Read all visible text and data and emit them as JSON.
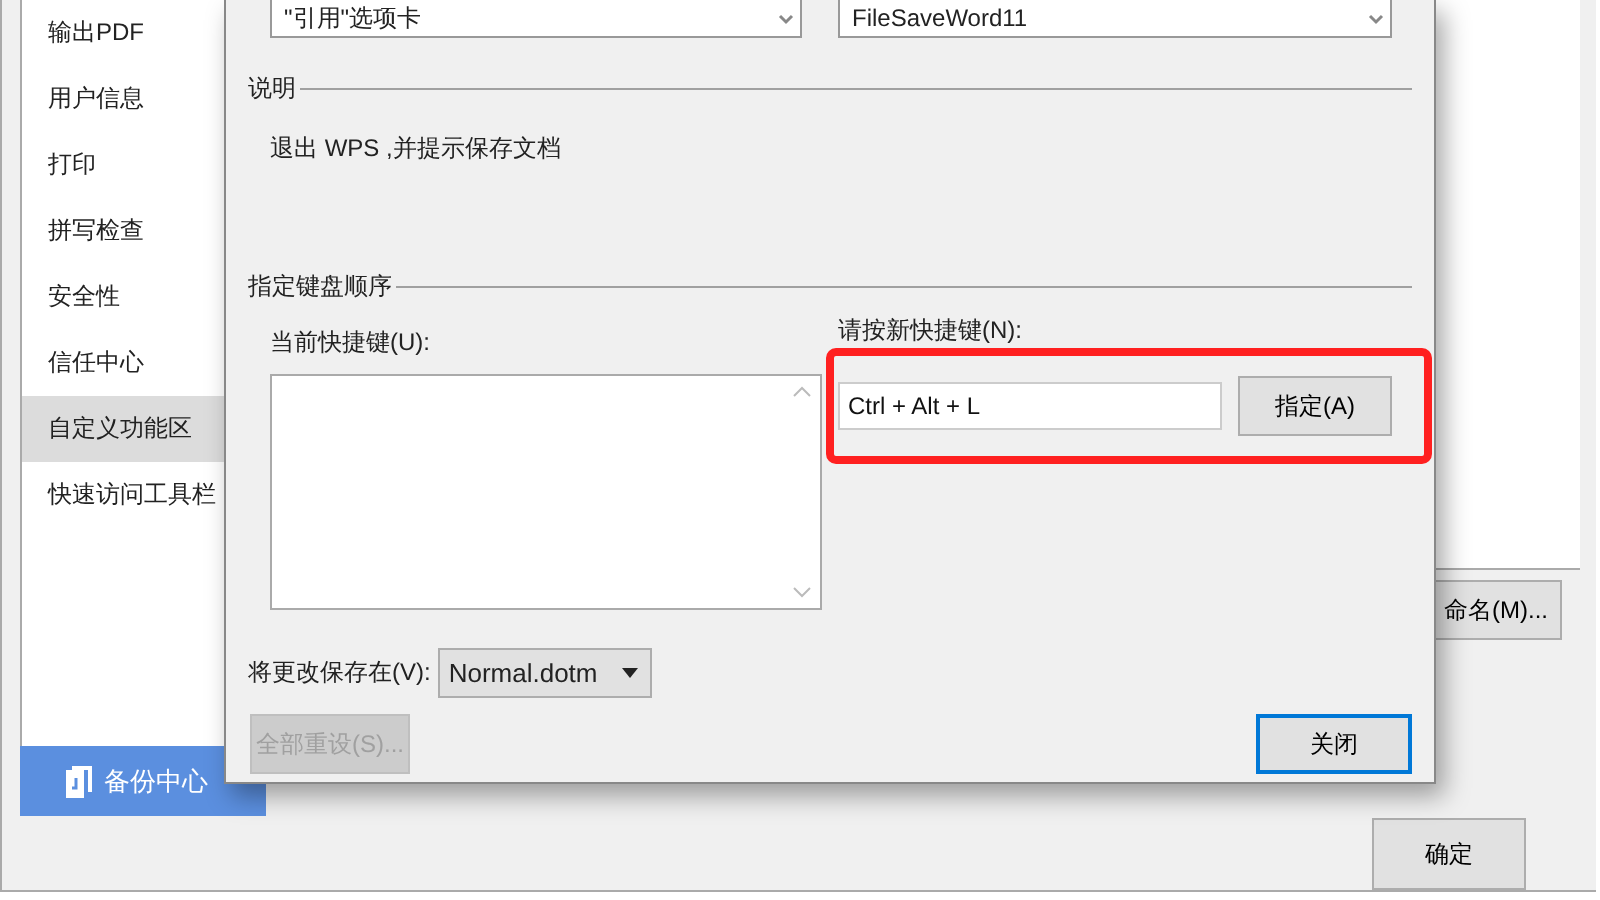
{
  "options_window": {
    "sidebar": [
      {
        "label": "输出PDF",
        "selected": false
      },
      {
        "label": "用户信息",
        "selected": false
      },
      {
        "label": "打印",
        "selected": false
      },
      {
        "label": "拼写检查",
        "selected": false
      },
      {
        "label": "安全性",
        "selected": false
      },
      {
        "label": "信任中心",
        "selected": false
      },
      {
        "label": "自定义功能区",
        "selected": true
      },
      {
        "label": "快速访问工具栏",
        "selected": false
      }
    ],
    "backup_button": "备份中心",
    "rename_button": "命名(M)...",
    "ok_button": "确定"
  },
  "dialog": {
    "categories_list": [
      "\"引用\"选项卡"
    ],
    "commands_list": [
      "FileSaveWord11"
    ],
    "description": {
      "heading": "说明",
      "text": "退出 WPS ,并提示保存文档"
    },
    "keyboard": {
      "heading": "指定键盘顺序",
      "current_label": "当前快捷键(U):",
      "new_label": "请按新快捷键(N):",
      "new_value": "Ctrl + Alt + L",
      "assign_button": "指定(A)"
    },
    "save_in": {
      "label": "将更改保存在(V):",
      "value": "Normal.dotm"
    },
    "reset_button": {
      "label": "全部重设(S)...",
      "disabled": true
    },
    "close_button": {
      "label": "关闭",
      "focused": true
    }
  }
}
